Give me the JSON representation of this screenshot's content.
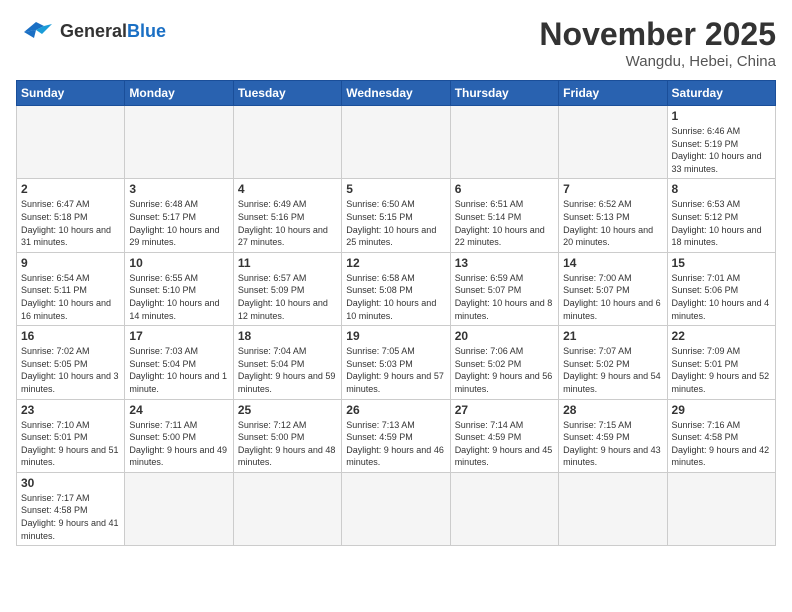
{
  "header": {
    "logo_general": "General",
    "logo_blue": "Blue",
    "month_title": "November 2025",
    "location": "Wangdu, Hebei, China"
  },
  "weekdays": [
    "Sunday",
    "Monday",
    "Tuesday",
    "Wednesday",
    "Thursday",
    "Friday",
    "Saturday"
  ],
  "days": {
    "1": {
      "sunrise": "6:46 AM",
      "sunset": "5:19 PM",
      "daylight": "10 hours and 33 minutes."
    },
    "2": {
      "sunrise": "6:47 AM",
      "sunset": "5:18 PM",
      "daylight": "10 hours and 31 minutes."
    },
    "3": {
      "sunrise": "6:48 AM",
      "sunset": "5:17 PM",
      "daylight": "10 hours and 29 minutes."
    },
    "4": {
      "sunrise": "6:49 AM",
      "sunset": "5:16 PM",
      "daylight": "10 hours and 27 minutes."
    },
    "5": {
      "sunrise": "6:50 AM",
      "sunset": "5:15 PM",
      "daylight": "10 hours and 25 minutes."
    },
    "6": {
      "sunrise": "6:51 AM",
      "sunset": "5:14 PM",
      "daylight": "10 hours and 22 minutes."
    },
    "7": {
      "sunrise": "6:52 AM",
      "sunset": "5:13 PM",
      "daylight": "10 hours and 20 minutes."
    },
    "8": {
      "sunrise": "6:53 AM",
      "sunset": "5:12 PM",
      "daylight": "10 hours and 18 minutes."
    },
    "9": {
      "sunrise": "6:54 AM",
      "sunset": "5:11 PM",
      "daylight": "10 hours and 16 minutes."
    },
    "10": {
      "sunrise": "6:55 AM",
      "sunset": "5:10 PM",
      "daylight": "10 hours and 14 minutes."
    },
    "11": {
      "sunrise": "6:57 AM",
      "sunset": "5:09 PM",
      "daylight": "10 hours and 12 minutes."
    },
    "12": {
      "sunrise": "6:58 AM",
      "sunset": "5:08 PM",
      "daylight": "10 hours and 10 minutes."
    },
    "13": {
      "sunrise": "6:59 AM",
      "sunset": "5:07 PM",
      "daylight": "10 hours and 8 minutes."
    },
    "14": {
      "sunrise": "7:00 AM",
      "sunset": "5:07 PM",
      "daylight": "10 hours and 6 minutes."
    },
    "15": {
      "sunrise": "7:01 AM",
      "sunset": "5:06 PM",
      "daylight": "10 hours and 4 minutes."
    },
    "16": {
      "sunrise": "7:02 AM",
      "sunset": "5:05 PM",
      "daylight": "10 hours and 3 minutes."
    },
    "17": {
      "sunrise": "7:03 AM",
      "sunset": "5:04 PM",
      "daylight": "10 hours and 1 minute."
    },
    "18": {
      "sunrise": "7:04 AM",
      "sunset": "5:04 PM",
      "daylight": "9 hours and 59 minutes."
    },
    "19": {
      "sunrise": "7:05 AM",
      "sunset": "5:03 PM",
      "daylight": "9 hours and 57 minutes."
    },
    "20": {
      "sunrise": "7:06 AM",
      "sunset": "5:02 PM",
      "daylight": "9 hours and 56 minutes."
    },
    "21": {
      "sunrise": "7:07 AM",
      "sunset": "5:02 PM",
      "daylight": "9 hours and 54 minutes."
    },
    "22": {
      "sunrise": "7:09 AM",
      "sunset": "5:01 PM",
      "daylight": "9 hours and 52 minutes."
    },
    "23": {
      "sunrise": "7:10 AM",
      "sunset": "5:01 PM",
      "daylight": "9 hours and 51 minutes."
    },
    "24": {
      "sunrise": "7:11 AM",
      "sunset": "5:00 PM",
      "daylight": "9 hours and 49 minutes."
    },
    "25": {
      "sunrise": "7:12 AM",
      "sunset": "5:00 PM",
      "daylight": "9 hours and 48 minutes."
    },
    "26": {
      "sunrise": "7:13 AM",
      "sunset": "4:59 PM",
      "daylight": "9 hours and 46 minutes."
    },
    "27": {
      "sunrise": "7:14 AM",
      "sunset": "4:59 PM",
      "daylight": "9 hours and 45 minutes."
    },
    "28": {
      "sunrise": "7:15 AM",
      "sunset": "4:59 PM",
      "daylight": "9 hours and 43 minutes."
    },
    "29": {
      "sunrise": "7:16 AM",
      "sunset": "4:58 PM",
      "daylight": "9 hours and 42 minutes."
    },
    "30": {
      "sunrise": "7:17 AM",
      "sunset": "4:58 PM",
      "daylight": "9 hours and 41 minutes."
    }
  }
}
